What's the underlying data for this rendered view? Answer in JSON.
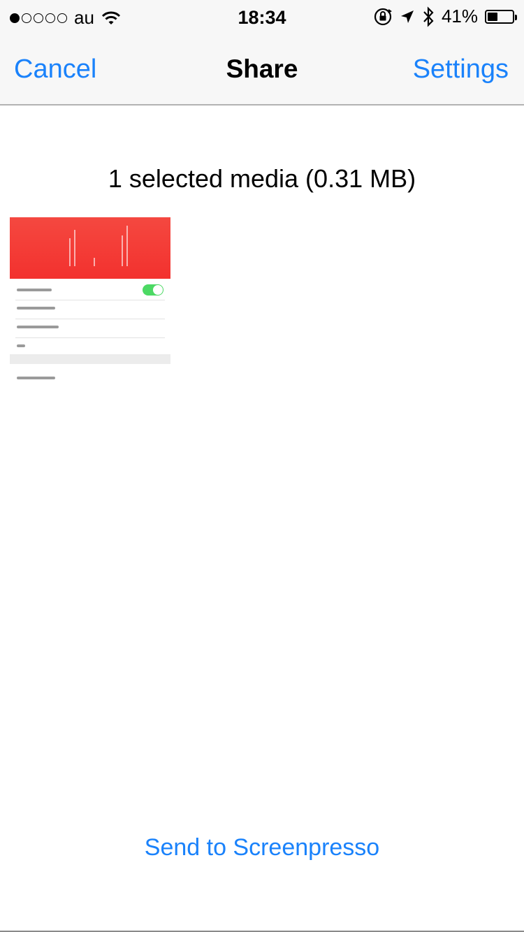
{
  "status_bar": {
    "carrier": "au",
    "time": "18:34",
    "battery_text": "41%",
    "battery_level": 0.41,
    "signal_filled": 1,
    "signal_total": 5
  },
  "nav": {
    "cancel_label": "Cancel",
    "title": "Share",
    "settings_label": "Settings"
  },
  "media": {
    "summary": "1 selected media (0.31 MB)"
  },
  "actions": {
    "send_label": "Send to Screenpresso"
  },
  "colors": {
    "accent": "#1a82fb",
    "thumb_red": "#f3312e",
    "toggle_green": "#4cd964"
  }
}
